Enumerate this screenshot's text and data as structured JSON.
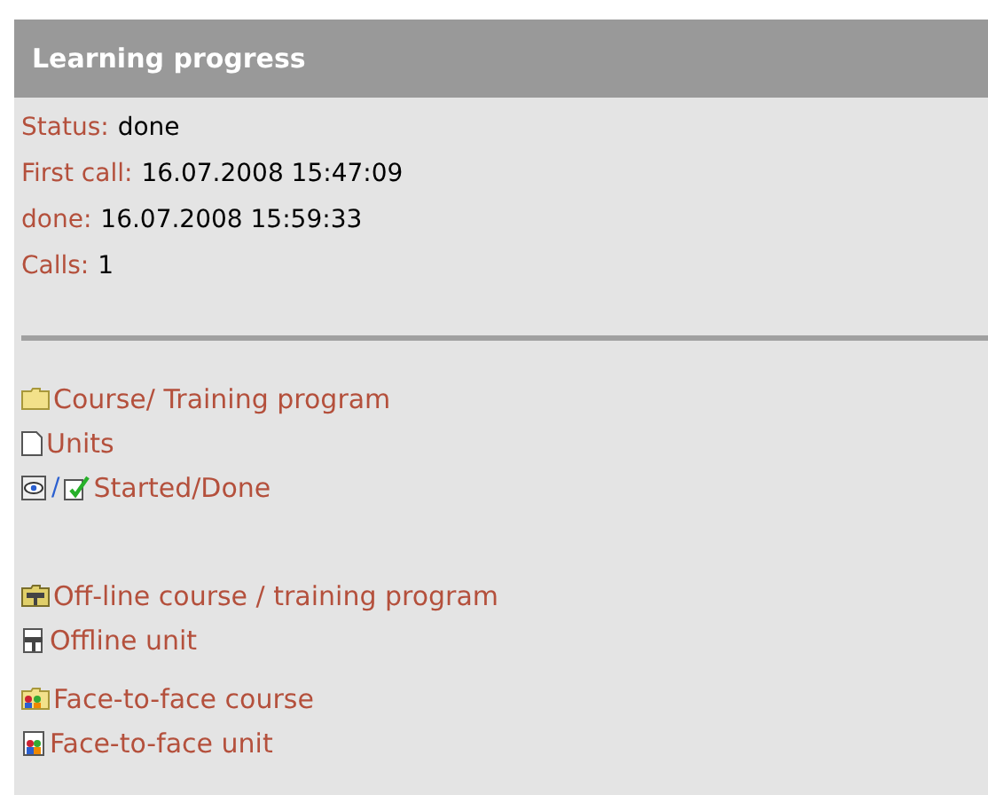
{
  "panel": {
    "title": "Learning progress"
  },
  "info": [
    {
      "label": "Status:",
      "value": "done"
    },
    {
      "label": "First call:",
      "value": "16.07.2008 15:47:09"
    },
    {
      "label": "done:",
      "value": "16.07.2008 15:59:33"
    },
    {
      "label": "Calls:",
      "value": "1"
    }
  ],
  "legend_groups": [
    [
      {
        "kind": "folder",
        "label": "Course/ Training program"
      },
      {
        "kind": "page",
        "label": "Units"
      },
      {
        "kind": "started-done",
        "separator": "/",
        "label": "Started/Done"
      }
    ],
    [
      {
        "kind": "offline-folder",
        "label": "Off-line course / training program"
      },
      {
        "kind": "offline-page",
        "label": "Offline unit"
      }
    ],
    [
      {
        "kind": "f2f-folder",
        "label": "Face-to-face course"
      },
      {
        "kind": "f2f-page",
        "label": "Face-to-face unit"
      }
    ]
  ]
}
